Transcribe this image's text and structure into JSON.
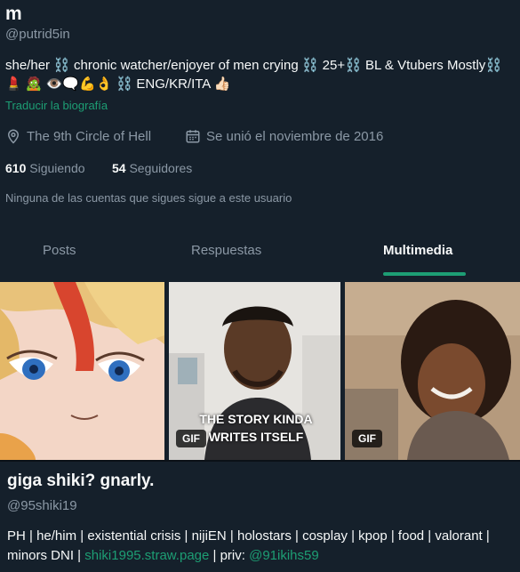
{
  "profile": {
    "name": "m",
    "handle": "@putrid5in",
    "bio": "she/her ⛓️ chronic watcher/enjoyer of men crying ⛓️ 25+⛓️ BL & Vtubers Mostly⛓️ 💄 🧟 👁️🗨️💪👌 ⛓️ ENG/KR/ITA 👍🏻",
    "translate_label": "Traducir la biografía",
    "location": "The 9th Circle of Hell",
    "joined": "Se unió el noviembre de 2016",
    "following_count": "610",
    "following_label": "Siguiendo",
    "followers_count": "54",
    "followers_label": "Seguidores",
    "mutual_notice": "Ninguna de las cuentas que sigues sigue a este usuario"
  },
  "tabs": [
    {
      "label": "Posts",
      "active": false
    },
    {
      "label": "Respuestas",
      "active": false
    },
    {
      "label": "Multimedia",
      "active": true
    }
  ],
  "media": [
    {
      "alt": "anime character",
      "gif": false
    },
    {
      "caption": "THE STORY KINDA WRITES ITSELF",
      "gif": true,
      "gif_label": "GIF"
    },
    {
      "alt": "woman laughing",
      "gif": true,
      "gif_label": "GIF"
    }
  ],
  "next_profile": {
    "name": "giga shiki? gnarly.",
    "handle": "@95shiki19",
    "bio_text": "PH | he/him | existential crisis | nijiEN | holostars | cosplay | kpop | food | valorant | minors DNI | ",
    "link": "shiki1995.straw.page",
    "priv_label": " | priv: ",
    "priv_handle": "@91ikihs59"
  },
  "colors": {
    "background": "#15202b",
    "accent": "#1d9e74",
    "muted": "#8b98a5"
  },
  "icons": [
    "location-icon",
    "calendar-icon"
  ]
}
